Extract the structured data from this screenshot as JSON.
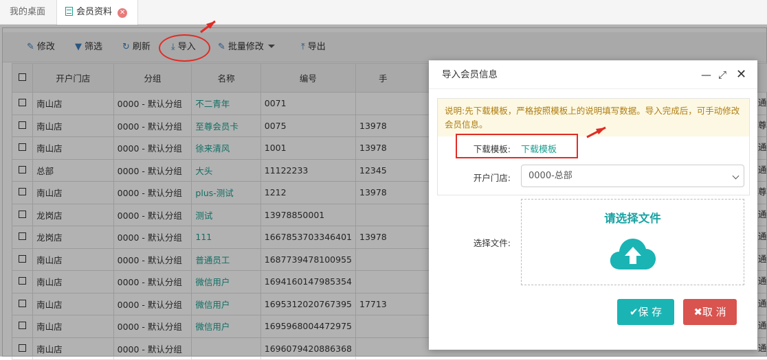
{
  "tabs": [
    {
      "label": "我的桌面"
    },
    {
      "label": "会员资料"
    }
  ],
  "toolbar": {
    "edit": "修改",
    "filter": "筛选",
    "refresh": "刷新",
    "import": "导入",
    "batch_edit": "批量修改",
    "export": "导出"
  },
  "table": {
    "headers": [
      "开户门店",
      "分组",
      "名称",
      "编号",
      "手"
    ],
    "rows": [
      {
        "store": "南山店",
        "group": "0000 - 默认分组",
        "name": "不二青年",
        "code": "0071",
        "phone": "",
        "tail": "通"
      },
      {
        "store": "南山店",
        "group": "0000 - 默认分组",
        "name": "至尊会员卡",
        "code": "0075",
        "phone": "13978",
        "tail": "尊"
      },
      {
        "store": "南山店",
        "group": "0000 - 默认分组",
        "name": "徐来清风",
        "code": "1001",
        "phone": "13978",
        "tail": "通"
      },
      {
        "store": "总部",
        "group": "0000 - 默认分组",
        "name": "大头",
        "code": "11122233",
        "phone": "12345",
        "tail": "通"
      },
      {
        "store": "南山店",
        "group": "0000 - 默认分组",
        "name": "plus-测试",
        "code": "1212",
        "phone": "13978",
        "tail": "尊"
      },
      {
        "store": "龙岗店",
        "group": "0000 - 默认分组",
        "name": "测试",
        "code": "13978850001",
        "phone": "",
        "tail": "通"
      },
      {
        "store": "龙岗店",
        "group": "0000 - 默认分组",
        "name": "111",
        "code": "1667853703346401",
        "phone": "13978",
        "tail": "通"
      },
      {
        "store": "南山店",
        "group": "0000 - 默认分组",
        "name": "普通员工",
        "code": "1687739478100955",
        "phone": "",
        "tail": "通"
      },
      {
        "store": "南山店",
        "group": "0000 - 默认分组",
        "name": "微信用户",
        "code": "1694160147985354",
        "phone": "",
        "tail": "通"
      },
      {
        "store": "南山店",
        "group": "0000 - 默认分组",
        "name": "微信用户",
        "code": "1695312020767395",
        "phone": "17713",
        "tail": "通"
      },
      {
        "store": "南山店",
        "group": "0000 - 默认分组",
        "name": "微信用户",
        "code": "1695968004472975",
        "phone": "",
        "tail": "通"
      },
      {
        "store": "南山店",
        "group": "0000 - 默认分组",
        "name": "",
        "code": "1696079420886368",
        "phone": "",
        "tail": "通"
      }
    ]
  },
  "dialog": {
    "title": "导入会员信息",
    "notice": "说明:先下载模板，严格按照模板上的说明填写数据。导入完成后，可手动修改会员信息。",
    "template_label": "下载模板:",
    "template_link": "下载模板",
    "store_label": "开户门店:",
    "store_value": "0000-总部",
    "file_label": "选择文件:",
    "file_prompt": "请选择文件",
    "save": "保 存",
    "cancel": "取 消"
  },
  "colors": {
    "accent": "#1a9e8f",
    "save_button": "#1ab4b4",
    "cancel_button": "#d9534f",
    "annotation": "#e12b25"
  }
}
